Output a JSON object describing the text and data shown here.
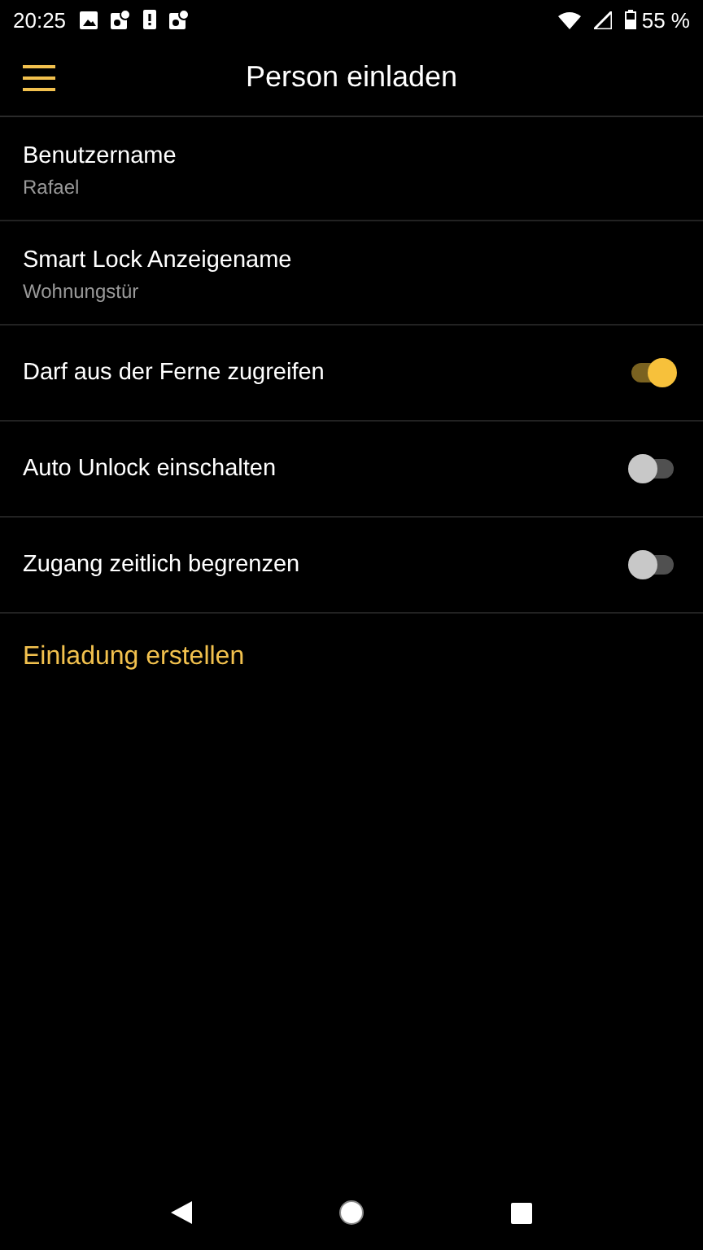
{
  "status_bar": {
    "time": "20:25",
    "battery": "55 %"
  },
  "app_bar": {
    "title": "Person einladen"
  },
  "fields": [
    {
      "label": "Benutzername",
      "value": "Rafael"
    },
    {
      "label": "Smart Lock Anzeigename",
      "value": "Wohnungstür"
    }
  ],
  "toggles": [
    {
      "label": "Darf aus der Ferne zugreifen",
      "on": true
    },
    {
      "label": "Auto Unlock einschalten",
      "on": false
    },
    {
      "label": "Zugang zeitlich begrenzen",
      "on": false
    }
  ],
  "action": {
    "label": "Einladung erstellen"
  }
}
